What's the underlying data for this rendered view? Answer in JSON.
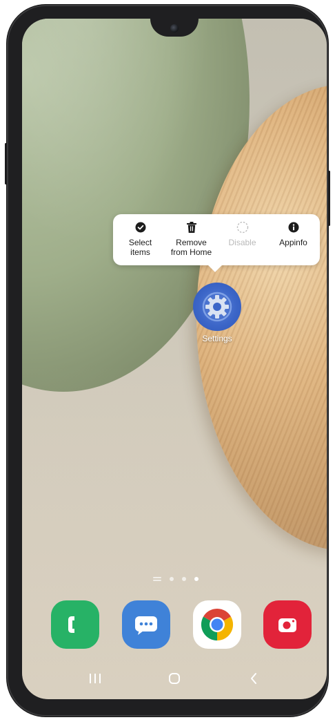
{
  "context_menu": {
    "items": [
      {
        "label": "Select\nitems",
        "icon": "check-circle-icon",
        "enabled": true
      },
      {
        "label": "Remove\nfrom Home",
        "icon": "trash-icon",
        "enabled": true
      },
      {
        "label": "Disable",
        "icon": "disable-dashed-circle-icon",
        "enabled": false
      },
      {
        "label": "Appinfo",
        "icon": "info-icon",
        "enabled": true
      }
    ]
  },
  "home": {
    "selected_app": {
      "label": "Settings",
      "icon": "gear-icon",
      "color": "#3c66c8"
    },
    "page_indicator": {
      "pages": 3,
      "active_index": 2
    }
  },
  "dock": {
    "apps": [
      {
        "name": "Phone",
        "icon": "phone-icon",
        "color": "#27b266"
      },
      {
        "name": "Messages",
        "icon": "messages-icon",
        "color": "#3f82d8"
      },
      {
        "name": "Chrome",
        "icon": "chrome-icon",
        "color": "#ffffff"
      },
      {
        "name": "Camera",
        "icon": "camera-icon",
        "color": "#e2233a"
      }
    ]
  },
  "nav_bar": {
    "buttons": [
      {
        "name": "recents",
        "icon": "recents-icon"
      },
      {
        "name": "home",
        "icon": "home-icon"
      },
      {
        "name": "back",
        "icon": "back-icon"
      }
    ]
  }
}
